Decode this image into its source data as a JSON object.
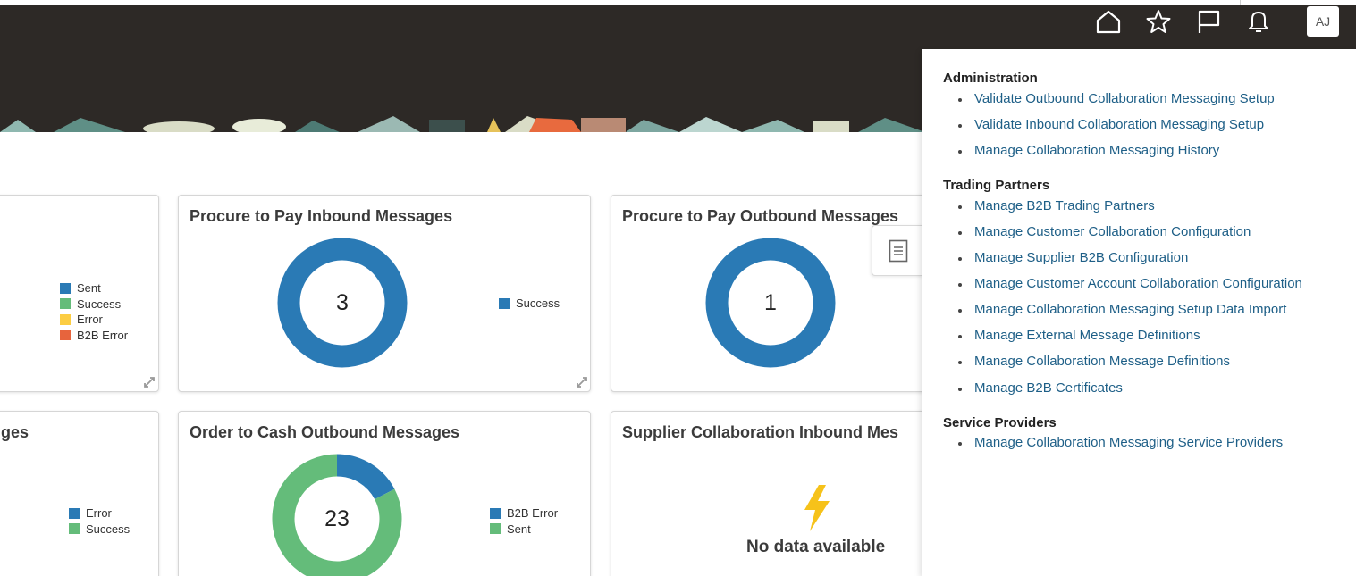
{
  "header": {
    "icons": [
      "home-icon",
      "star-icon",
      "flag-icon",
      "bell-icon"
    ],
    "avatar_initials": "AJ",
    "background": "#2d2926"
  },
  "cards": {
    "p2p_inbound": {
      "title": "Procure to Pay Inbound Messages",
      "center": "3",
      "legend": [
        {
          "label": "Success",
          "color": "#2a7ab5"
        }
      ]
    },
    "p2p_outbound": {
      "title": "Procure to Pay Outbound Messages",
      "center": "1"
    },
    "left_top": {
      "legend": [
        {
          "label": "Sent",
          "color": "#2a7ab5"
        },
        {
          "label": "Success",
          "color": "#64bc7a"
        },
        {
          "label": "Error",
          "color": "#fccd43"
        },
        {
          "label": "B2B Error",
          "color": "#e7643d"
        }
      ]
    },
    "left_bottom": {
      "title_fragment": "ges",
      "legend": [
        {
          "label": "Error",
          "color": "#2a7ab5"
        },
        {
          "label": "Success",
          "color": "#64bc7a"
        }
      ]
    },
    "o2c_outbound": {
      "title": "Order to Cash Outbound Messages",
      "center": "23",
      "legend": [
        {
          "label": "B2B Error",
          "color": "#2a7ab5"
        },
        {
          "label": "Sent",
          "color": "#64bc7a"
        }
      ]
    },
    "supplier_inbound": {
      "title": "Supplier Collaboration Inbound Mes",
      "no_data": "No data available"
    }
  },
  "chart_data": [
    {
      "type": "pie",
      "title": "Procure to Pay Inbound Messages",
      "categories": [
        "Success"
      ],
      "values": [
        3
      ],
      "hole": true
    },
    {
      "type": "pie",
      "title": "Procure to Pay Outbound Messages",
      "categories": [],
      "values": [
        1
      ],
      "hole": true
    },
    {
      "type": "pie",
      "title": "Order to Cash Outbound Messages",
      "categories": [
        "B2B Error",
        "Sent"
      ],
      "values": [
        4,
        19
      ],
      "hole": true
    }
  ],
  "panel": {
    "sections": [
      {
        "title": "Administration",
        "links": [
          "Validate Outbound Collaboration Messaging Setup",
          "Validate Inbound Collaboration Messaging Setup",
          "Manage Collaboration Messaging History"
        ]
      },
      {
        "title": "Trading Partners",
        "links": [
          "Manage B2B Trading Partners",
          "Manage Customer Collaboration Configuration",
          "Manage Supplier B2B Configuration",
          "Manage Customer Account Collaboration Configuration",
          "Manage Collaboration Messaging Setup Data Import",
          "Manage External Message Definitions",
          "Manage Collaboration Message Definitions",
          "Manage B2B Certificates"
        ]
      },
      {
        "title": "Service Providers",
        "links": [
          "Manage Collaboration Messaging Service Providers"
        ]
      }
    ]
  }
}
